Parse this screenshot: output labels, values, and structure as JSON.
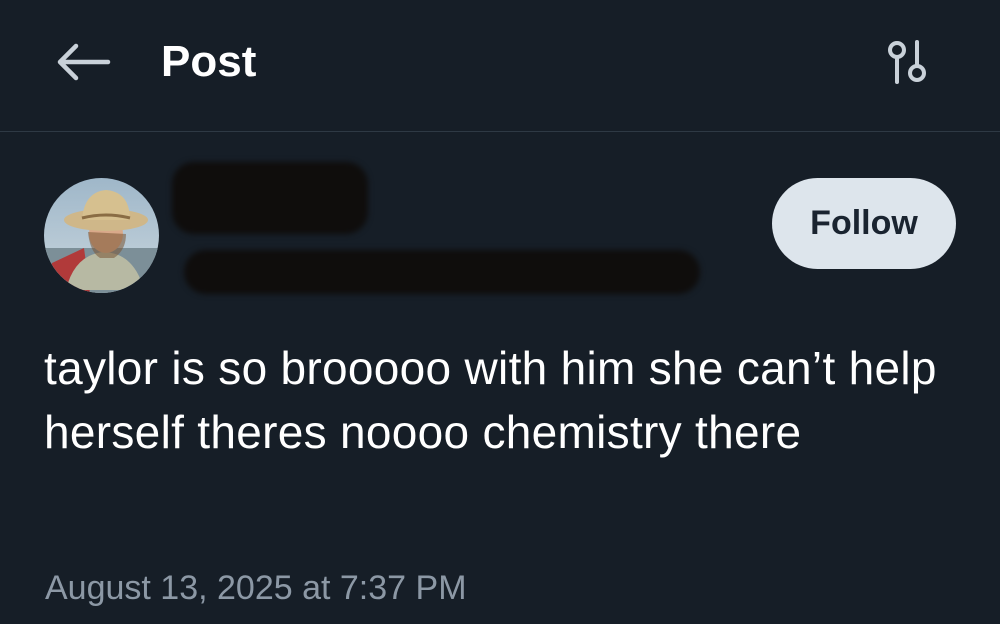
{
  "header": {
    "title": "Post",
    "back_icon": "arrow-left-icon",
    "settings_icon": "sliders-icon"
  },
  "author": {
    "avatar_icon": "profile-photo",
    "follow_label": "Follow"
  },
  "post": {
    "text": "taylor is so brooooo with him she can’t help herself theres noooo chemistry there",
    "timestamp": "August 13, 2025 at 7:37 PM"
  },
  "colors": {
    "background": "#161e27",
    "follow_bg": "#dde5ec",
    "muted_text": "#8c98a5"
  }
}
